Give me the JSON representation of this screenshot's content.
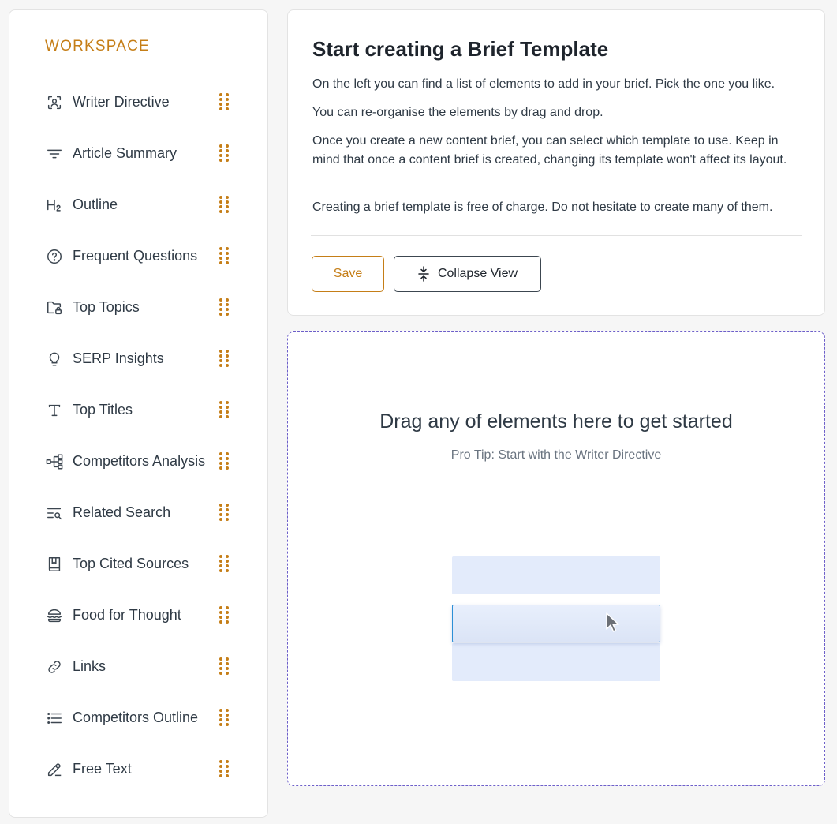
{
  "sidebar": {
    "heading": "WORKSPACE",
    "items": [
      {
        "label": "Writer Directive",
        "icon": "scan-user-icon"
      },
      {
        "label": "Article Summary",
        "icon": "filter-lines-icon"
      },
      {
        "label": "Outline",
        "icon": "heading-2-icon"
      },
      {
        "label": "Frequent Questions",
        "icon": "question-circle-icon"
      },
      {
        "label": "Top Topics",
        "icon": "folder-lock-icon"
      },
      {
        "label": "SERP Insights",
        "icon": "lightbulb-icon"
      },
      {
        "label": "Top Titles",
        "icon": "type-icon"
      },
      {
        "label": "Competitors Analysis",
        "icon": "network-icon"
      },
      {
        "label": "Related Search",
        "icon": "list-search-icon"
      },
      {
        "label": "Top Cited Sources",
        "icon": "book-bookmark-icon"
      },
      {
        "label": "Food for Thought",
        "icon": "burger-icon"
      },
      {
        "label": "Links",
        "icon": "link-icon"
      },
      {
        "label": "Competitors Outline",
        "icon": "list-icon"
      },
      {
        "label": "Free Text",
        "icon": "pencil-icon"
      }
    ]
  },
  "intro": {
    "title": "Start creating a Brief Template",
    "paragraphs": [
      "On the left you can find a list of elements to add in your brief. Pick the one you like.",
      "You can re-organise the elements by drag and drop.",
      "Once you create a new content brief, you can select which template to use. Keep in mind that once a content brief is created, changing its template won't affect its layout.",
      "Creating a brief template is free of charge. Do not hesitate to create many of them."
    ],
    "save_label": "Save",
    "collapse_label": "Collapse View"
  },
  "dropzone": {
    "title": "Drag any of elements here to get started",
    "tip": "Pro Tip: Start with the Writer Directive"
  },
  "colors": {
    "accent": "#c57e17",
    "dropzone_border": "#6d5fc9"
  }
}
